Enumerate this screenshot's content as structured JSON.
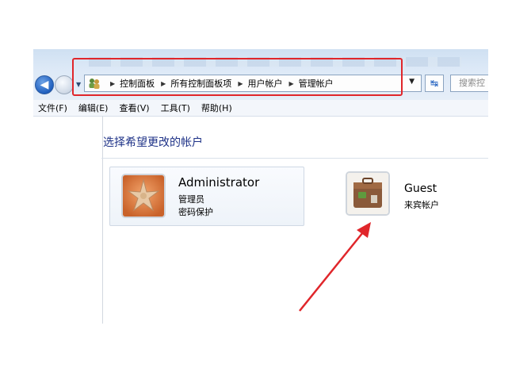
{
  "addressbar": {
    "breadcrumbs": [
      "控制面板",
      "所有控制面板项",
      "用户帐户",
      "管理帐户"
    ],
    "search_placeholder": "搜索控"
  },
  "menu": {
    "items": [
      "文件(F)",
      "编辑(E)",
      "查看(V)",
      "工具(T)",
      "帮助(H)"
    ]
  },
  "page": {
    "heading": "选择希望更改的帐户"
  },
  "accounts": [
    {
      "name": "Administrator",
      "type": "管理员",
      "status": "密码保护"
    },
    {
      "name": "Guest",
      "type": "来宾帐户"
    }
  ],
  "colors": {
    "highlight": "#e0262b",
    "heading": "#1e3287"
  },
  "icons": {
    "back": "back-arrow-icon",
    "forward": "forward-arrow-icon",
    "address": "users-icon",
    "refresh": "refresh-icon"
  }
}
